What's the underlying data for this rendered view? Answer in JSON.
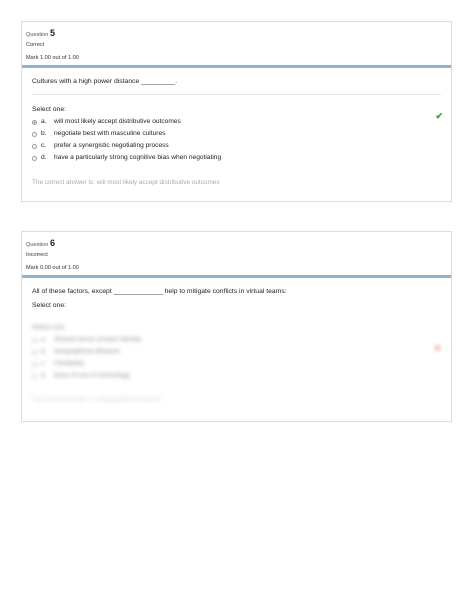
{
  "q5": {
    "label": "Question",
    "number": "5",
    "state": "Correct",
    "grade": "Mark 1.00 out of 1.00",
    "text": "Cultures with a high power distance _________.",
    "prompt": "Select one:",
    "options": [
      {
        "letter": "a.",
        "text": "will most likely accept distributive outcomes"
      },
      {
        "letter": "b.",
        "text": "negotiate best with masculine cultures"
      },
      {
        "letter": "c.",
        "text": "prefer a synergistic negotiating process"
      },
      {
        "letter": "d.",
        "text": "have a particularly strong cognitive bias when negotiating"
      }
    ],
    "feedback": "The correct answer is: will most likely accept distributive outcomes",
    "check_icon": "check-icon",
    "check_color": "#2e9e3e"
  },
  "q6": {
    "label": "Question",
    "number": "6",
    "state": "Incorrect",
    "grade": "Mark 0.00 out of 1.00",
    "text": "All of these factors, except _____________ help to mitigate conflicts in virtual teams:",
    "prompt": "Select one:",
    "options": [
      {
        "letter": "a.",
        "text": "Shared sense of team identity"
      },
      {
        "letter": "b.",
        "text": "Geographical distance"
      },
      {
        "letter": "c.",
        "text": "Familiarity"
      },
      {
        "letter": "d.",
        "text": "Ease of use of technology"
      }
    ],
    "feedback": "The correct answer is: Geographical distance",
    "cross_icon": "cross-icon",
    "cross_color": "#d9534f"
  },
  "colors": {
    "accent_bar": "#8fb3d1"
  }
}
